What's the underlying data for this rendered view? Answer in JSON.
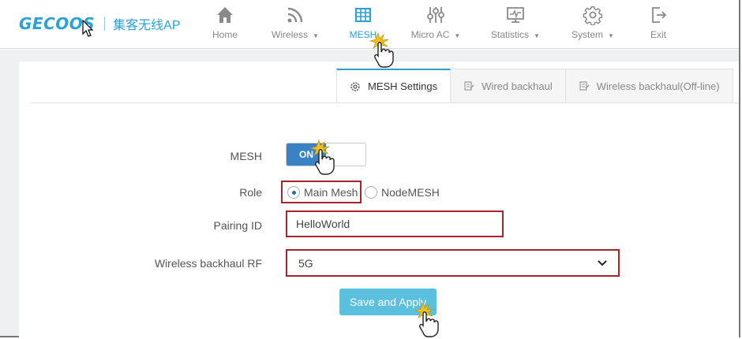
{
  "brand": {
    "logo": "GECOOS",
    "subtitle": "集客无线AP"
  },
  "colors": {
    "accent": "#2ba1d6",
    "highlight": "#a4262c",
    "toggle_on": "#3b82c4",
    "button": "#5bc0de"
  },
  "nav": {
    "home": "Home",
    "wireless": "Wireless",
    "mesh": "MESH",
    "micro_ac": "Micro AC",
    "statistics": "Statistics",
    "system": "System",
    "exit": "Exit"
  },
  "tabs": {
    "mesh_settings": "MESH Settings",
    "wired_backhaul": "Wired backhaul",
    "wireless_backhaul": "Wireless backhaul(Off-line)"
  },
  "form": {
    "mesh_label": "MESH",
    "mesh_toggle": "ON",
    "role_label": "Role",
    "role_main": "Main Mesh",
    "role_node": "NodeMESH",
    "pairing_label": "Pairing ID",
    "pairing_value": "HelloWorld",
    "rf_label": "Wireless backhaul RF",
    "rf_value": "5G",
    "save": "Save and Apply"
  }
}
